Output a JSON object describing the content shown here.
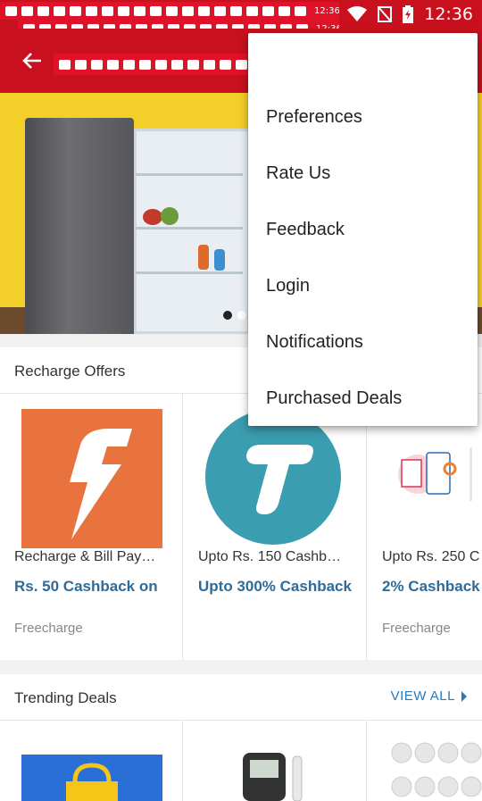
{
  "status_bar": {
    "time": "12:36",
    "glitch_time": "12:36"
  },
  "app_bar": {
    "back_icon": "arrow-left-icon"
  },
  "colors": {
    "primary": "#c8101e",
    "link": "#2a7ab8",
    "cashback": "#2c6c9c"
  },
  "overflow_menu": {
    "items": [
      "Preferences",
      "Rate Us",
      "Feedback",
      "Login",
      "Notifications",
      "Purchased Deals"
    ]
  },
  "recharge_offers": {
    "title": "Recharge Offers",
    "cards": [
      {
        "title": "Recharge & Bill Pay…",
        "cashback": "Rs. 50 Cashback on",
        "merchant": "Freecharge",
        "logo": "freecharge-logo"
      },
      {
        "title": "Upto Rs. 150 Cashb…",
        "cashback": "Upto 300% Cashback",
        "merchant": "",
        "logo": "tcash-logo"
      },
      {
        "title": "Upto Rs. 250 C",
        "cashback": "2% Cashback",
        "merchant": "Freecharge",
        "logo": "bill-pay-illustration"
      }
    ]
  },
  "trending_deals": {
    "title": "Trending Deals",
    "view_all": "VIEW ALL"
  }
}
